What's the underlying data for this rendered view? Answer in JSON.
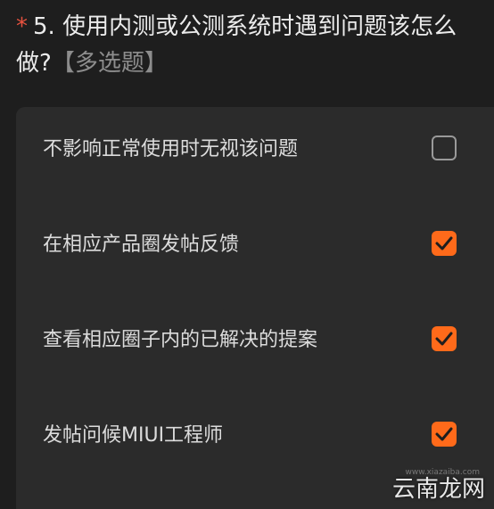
{
  "question": {
    "required_mark": "*",
    "title": "5. 使用内测或公测系统时遇到问题该怎么做?",
    "type_label": "【多选题】"
  },
  "options": [
    {
      "label": "不影响正常使用时无视该问题",
      "checked": false
    },
    {
      "label": "在相应产品圈发帖反馈",
      "checked": true
    },
    {
      "label": "查看相应圈子内的已解决的提案",
      "checked": true
    },
    {
      "label": "发帖问候MIUI工程师",
      "checked": true
    }
  ],
  "colors": {
    "accent": "#ff6a1a",
    "required": "#e8523f"
  },
  "watermark": {
    "brand": "云南龙网",
    "url": "www.xiazaiba.com"
  }
}
